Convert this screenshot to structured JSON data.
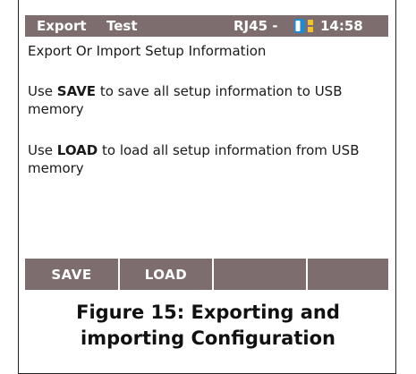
{
  "titlebar": {
    "mode": "Export",
    "test": "Test",
    "port": "RJ45 -",
    "time": "14:58",
    "battery_icon": "battery-icon",
    "accent_colors": {
      "bar": "#7d6d6f",
      "battery": "#1d8ad6",
      "battery_dots": "#f2c230"
    }
  },
  "content": {
    "heading": "Export Or Import Setup Information",
    "save_pre": "Use ",
    "save_key": "SAVE",
    "save_post": " to save all setup information to USB memory",
    "load_pre": "Use ",
    "load_key": "LOAD",
    "load_post": " to load all setup information from USB memory"
  },
  "softkeys": [
    {
      "label": "SAVE"
    },
    {
      "label": "LOAD"
    },
    {
      "label": ""
    },
    {
      "label": ""
    }
  ],
  "caption": {
    "line1": "Figure 15: Exporting and",
    "line2": "importing Configuration"
  }
}
